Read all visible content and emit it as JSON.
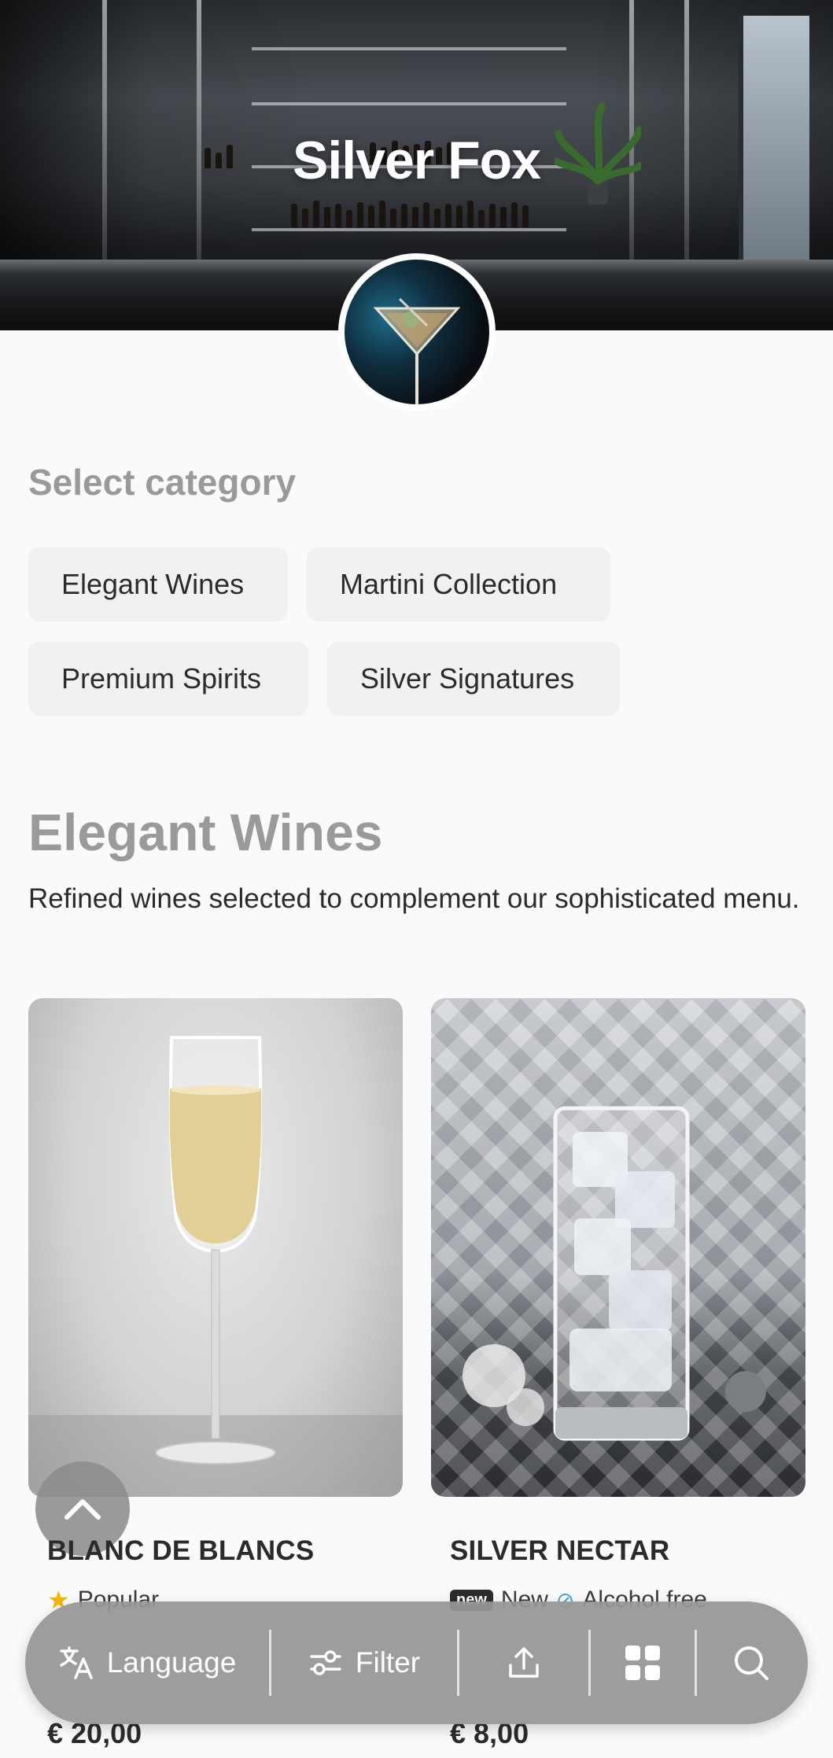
{
  "venue": {
    "name": "Silver Fox"
  },
  "categories": {
    "heading": "Select category",
    "items": [
      {
        "label": "Elegant Wines"
      },
      {
        "label": "Martini Collection"
      },
      {
        "label": "Premium Spirits"
      },
      {
        "label": "Silver Signatures"
      }
    ]
  },
  "current_category": {
    "title": "Elegant Wines",
    "description": "Refined wines selected to complement our sophisticated menu."
  },
  "products": [
    {
      "name": "BLANC DE BLANCS",
      "badges": [
        {
          "icon": "star-icon",
          "label": "Popular"
        }
      ],
      "price": "€ 20,00"
    },
    {
      "name": "SILVER NECTAR",
      "badges": [
        {
          "icon": "new-badge",
          "label": "New"
        },
        {
          "icon": "alcohol-free-icon",
          "label": "Alcohol free"
        }
      ],
      "price": "€ 8,00"
    }
  ],
  "bottom_bar": {
    "language_label": "Language",
    "filter_label": "Filter",
    "icons": [
      "translate-icon",
      "filter-icon",
      "share-icon",
      "grid-icon",
      "search-icon"
    ]
  },
  "colors": {
    "muted_heading": "#9a9a9a",
    "chip_bg": "#f1f1f1",
    "bar_bg": "#969696",
    "text": "#2b2b2b"
  }
}
